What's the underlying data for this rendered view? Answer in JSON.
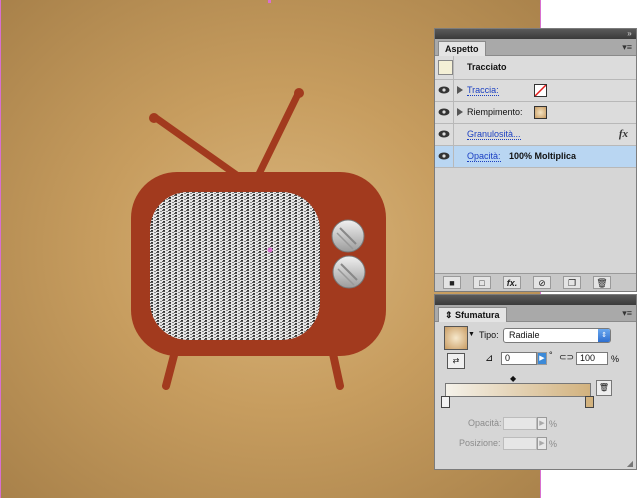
{
  "aspetto_panel": {
    "tab_label": "Aspetto",
    "object_type": "Tracciato",
    "rows": {
      "traccia_label": "Traccia:",
      "riempimento_label": "Riempimento:",
      "granulosita_label": "Granulosità...",
      "opacita_label": "Opacità:",
      "opacita_value": "100% Moltiplica"
    },
    "fx_label": "fx",
    "bottom_buttons": [
      "■",
      "□",
      "fx.",
      "⊘",
      "❐",
      "🗑"
    ]
  },
  "sfumatura_panel": {
    "tab_label": "Sfumatura",
    "tipo_label": "Tipo:",
    "tipo_value": "Radiale",
    "angle_value": "0",
    "degree_symbol": "°",
    "aspect_value": "100",
    "percent_symbol": "%",
    "opacita_label": "Opacità:",
    "posizione_label": "Posizione:",
    "percent_symbol_2": "%",
    "percent_symbol_3": "%"
  },
  "colors": {
    "tv_body": "#a23a1e",
    "background_center": "#d9b57c",
    "background_edge": "#a8814a",
    "selection_row": "#b9d6f2",
    "artboard_guide": "#d86fd0"
  }
}
